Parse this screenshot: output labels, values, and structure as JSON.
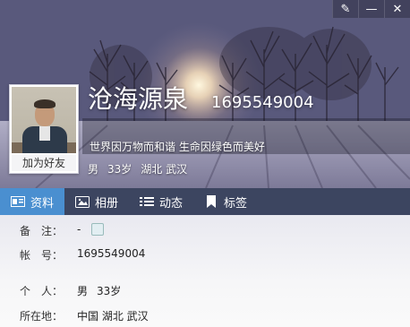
{
  "profile": {
    "nickname": "沧海源泉",
    "qq_number": "1695549004",
    "signature": "世界因万物而和谐 生命因绿色而美好",
    "gender": "男",
    "age": "33岁",
    "location_short": "湖北 武汉",
    "add_friend": "加为好友"
  },
  "tabs": [
    {
      "label": "资料",
      "icon": "profile-card-icon"
    },
    {
      "label": "相册",
      "icon": "photo-album-icon"
    },
    {
      "label": "动态",
      "icon": "feed-list-icon"
    },
    {
      "label": "标签",
      "icon": "bookmark-icon"
    }
  ],
  "details": {
    "remark_label": "备　注：",
    "remark_value": "-",
    "account_label": "帐　号：",
    "account_value": "1695549004",
    "personal_label": "个　人：",
    "personal_gender": "男",
    "personal_age": "33岁",
    "location_label": "所在地：",
    "location_value": "中国 湖北 武汉"
  },
  "colors": {
    "tab_active": "#4a8fd0",
    "tab_bar": "#283250"
  }
}
